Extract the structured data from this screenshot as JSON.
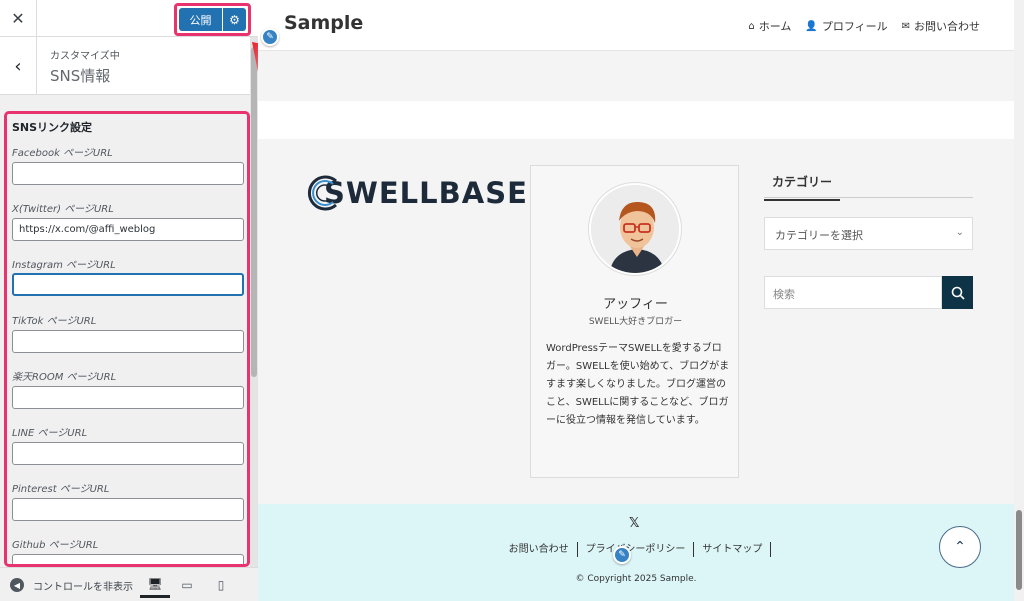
{
  "customizer": {
    "close_icon": "close-icon",
    "publish_label": "公開",
    "customizing_label": "カスタマイズ中",
    "section_title": "SNS情報",
    "sns_heading": "SNSリンク設定",
    "fields": [
      {
        "label": "Facebook ページURL",
        "value": ""
      },
      {
        "label": "X(Twitter) ページURL",
        "value": "https://x.com/@affi_weblog"
      },
      {
        "label": "Instagram ページURL",
        "value": ""
      },
      {
        "label": "TikTok ページURL",
        "value": ""
      },
      {
        "label": "楽天ROOM ページURL",
        "value": ""
      },
      {
        "label": "LINE ページURL",
        "value": ""
      },
      {
        "label": "Pinterest ページURL",
        "value": ""
      },
      {
        "label": "Github ページURL",
        "value": ""
      }
    ],
    "collapse_label": "コントロールを非表示"
  },
  "preview": {
    "site_title": "Sample",
    "nav": [
      {
        "icon": "home-icon",
        "glyph": "⌂",
        "label": "ホーム"
      },
      {
        "icon": "user-icon",
        "glyph": "👤",
        "label": "プロフィール"
      },
      {
        "icon": "mail-icon",
        "glyph": "✉",
        "label": "お問い合わせ"
      }
    ],
    "logo_text": "SWELLBASE",
    "profile": {
      "name": "アッフィー",
      "role": "SWELL大好きブロガー",
      "bio": "WordPressテーマSWELLを愛するブロガー。SWELLを使い始めて、ブログがますます楽しくなりました。ブログ運営のこと、SWELLに関することなど、ブロガーに役立つ情報を発信しています。"
    },
    "category_heading": "カテゴリー",
    "category_select": "カテゴリーを選択",
    "search_placeholder": "検索",
    "footer_links": [
      "お問い合わせ",
      "プライバシーポリシー",
      "サイトマップ"
    ],
    "copyright": "© Copyright 2025 Sample.",
    "x_icon": "𝕏"
  },
  "colors": {
    "highlight": "#e8336f",
    "wp_blue": "#2271b1",
    "footer_bg": "#dcf5f7",
    "search_btn": "#0e3347"
  }
}
